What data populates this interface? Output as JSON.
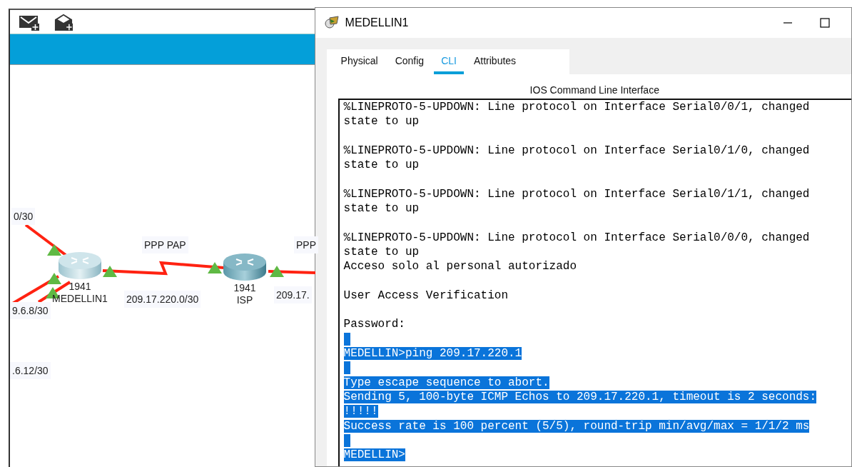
{
  "topology": {
    "labels": [
      "0/30",
      "PPP PAP",
      "PPP",
      "9.6.8/30",
      "209.17.220.0/30",
      "209.17.",
      ".6.12/30"
    ],
    "devices": [
      {
        "model": "1941",
        "name": "MEDELLIN1"
      },
      {
        "model": "1941",
        "name": "ISP"
      }
    ]
  },
  "window": {
    "title": "MEDELLIN1",
    "tabs": [
      {
        "label": "Physical",
        "selected": false
      },
      {
        "label": "Config",
        "selected": false
      },
      {
        "label": "CLI",
        "selected": true
      },
      {
        "label": "Attributes",
        "selected": false
      }
    ],
    "heading": "IOS Command Line Interface",
    "terminal_lines": [
      {
        "kind": "text",
        "text": "%LINEPROTO-5-UPDOWN: Line protocol on Interface Serial0/0/1, changed",
        "selected": false
      },
      {
        "kind": "text",
        "text": "state to up",
        "selected": false
      },
      {
        "kind": "blank"
      },
      {
        "kind": "text",
        "text": "%LINEPROTO-5-UPDOWN: Line protocol on Interface Serial0/1/0, changed",
        "selected": false
      },
      {
        "kind": "text",
        "text": "state to up",
        "selected": false
      },
      {
        "kind": "blank"
      },
      {
        "kind": "text",
        "text": "%LINEPROTO-5-UPDOWN: Line protocol on Interface Serial0/1/1, changed",
        "selected": false
      },
      {
        "kind": "text",
        "text": "state to up",
        "selected": false
      },
      {
        "kind": "blank"
      },
      {
        "kind": "text",
        "text": "%LINEPROTO-5-UPDOWN: Line protocol on Interface Serial0/0/0, changed",
        "selected": false
      },
      {
        "kind": "text",
        "text": "state to up",
        "selected": false
      },
      {
        "kind": "text",
        "text": "Acceso solo al personal autorizado",
        "selected": false
      },
      {
        "kind": "blank"
      },
      {
        "kind": "text",
        "text": "User Access Verification",
        "selected": false
      },
      {
        "kind": "blank"
      },
      {
        "kind": "text",
        "text": "Password:",
        "selected": false
      },
      {
        "kind": "blank",
        "selected": true
      },
      {
        "kind": "text",
        "text": "MEDELLIN>ping 209.17.220.1",
        "selected": true
      },
      {
        "kind": "blank",
        "selected": true
      },
      {
        "kind": "text",
        "text": "Type escape sequence to abort.",
        "selected": true
      },
      {
        "kind": "text",
        "text": "Sending 5, 100-byte ICMP Echos to 209.17.220.1, timeout is 2 seconds:",
        "selected": true
      },
      {
        "kind": "text",
        "text": "!!!!!",
        "selected": true
      },
      {
        "kind": "text",
        "text": "Success rate is 100 percent (5/5), round-trip min/avg/max = 1/1/2 ms",
        "selected": true
      },
      {
        "kind": "blank",
        "selected": true
      },
      {
        "kind": "text",
        "text": "MEDELLIN>",
        "selected": true
      }
    ]
  }
}
